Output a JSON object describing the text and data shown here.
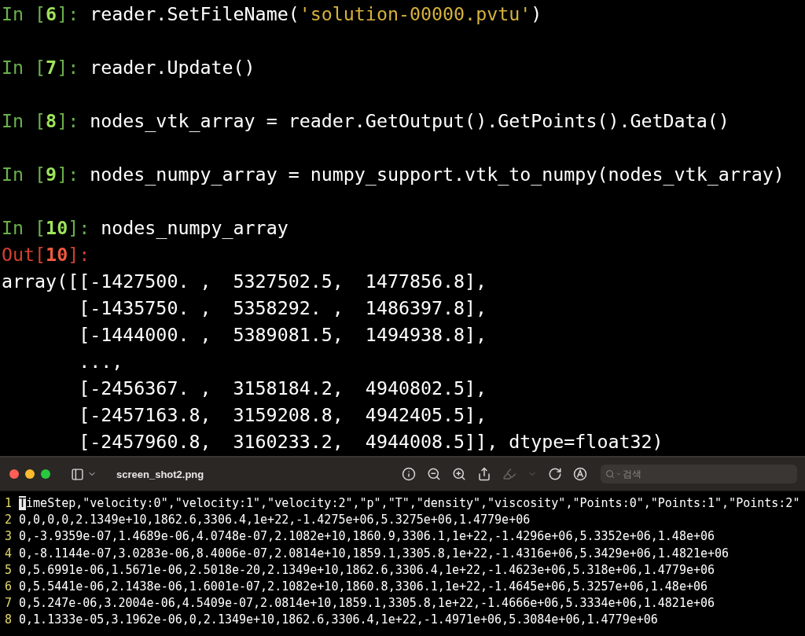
{
  "terminal": {
    "cells": [
      {
        "kind": "input",
        "prompt_open": "In [",
        "number": "6",
        "prompt_close": "]: ",
        "code": [
          {
            "kind": "plain",
            "text": "reader.SetFileName("
          },
          {
            "kind": "string",
            "text": "'solution-00000.pvtu'"
          },
          {
            "kind": "plain",
            "text": ")"
          }
        ]
      },
      {
        "kind": "input",
        "prompt_open": "In [",
        "number": "7",
        "prompt_close": "]: ",
        "code": [
          {
            "kind": "plain",
            "text": "reader.Update()"
          }
        ]
      },
      {
        "kind": "input",
        "prompt_open": "In [",
        "number": "8",
        "prompt_close": "]: ",
        "code": [
          {
            "kind": "plain",
            "text": "nodes_vtk_array = reader.GetOutput().GetPoints().GetData()"
          }
        ]
      },
      {
        "kind": "input",
        "prompt_open": "In [",
        "number": "9",
        "prompt_close": "]: ",
        "code": [
          {
            "kind": "plain",
            "text": "nodes_numpy_array = numpy_support.vtk_to_numpy(nodes_vtk_array)"
          }
        ]
      },
      {
        "kind": "input",
        "prompt_open": "In [",
        "number": "10",
        "prompt_close": "]: ",
        "code": [
          {
            "kind": "plain",
            "text": "nodes_numpy_array"
          }
        ]
      },
      {
        "kind": "output",
        "prompt_open": "Out[",
        "number": "10",
        "prompt_close": "]:",
        "lines": [
          "array([[-1427500. ,  5327502.5,  1477856.8],",
          "       [-1435750. ,  5358292. ,  1486397.8],",
          "       [-1444000. ,  5389081.5,  1494938.8],",
          "       ...,",
          "       [-2456367. ,  3158184.2,  4940802.5],",
          "       [-2457163.8,  3159208.8,  4942405.5],",
          "       [-2457960.8,  3160233.2,  4944008.5]], dtype=float32)"
        ]
      }
    ]
  },
  "viewer": {
    "title": "screen_shot2.png",
    "search": {
      "placeholder": "검색"
    },
    "toolbar": [
      {
        "kind": "info",
        "disabled": false
      },
      {
        "kind": "zoom-out",
        "disabled": false
      },
      {
        "kind": "zoom-in",
        "disabled": false
      },
      {
        "kind": "share",
        "disabled": false
      },
      {
        "kind": "highlight",
        "disabled": true
      },
      {
        "kind": "menu-caret",
        "disabled": true
      },
      {
        "kind": "rotate",
        "disabled": false
      },
      {
        "kind": "markup",
        "disabled": false
      }
    ],
    "lines": [
      {
        "number": "1",
        "text": "TimeStep,\"velocity:0\",\"velocity:1\",\"velocity:2\",\"p\",\"T\",\"density\",\"viscosity\",\"Points:0\",\"Points:1\",\"Points:2\"",
        "cursor": true
      },
      {
        "number": "2",
        "text": "0,0,0,0,2.1349e+10,1862.6,3306.4,1e+22,-1.4275e+06,5.3275e+06,1.4779e+06",
        "cursor": false
      },
      {
        "number": "3",
        "text": "0,-3.9359e-07,1.4689e-06,4.0748e-07,2.1082e+10,1860.9,3306.1,1e+22,-1.4296e+06,5.3352e+06,1.48e+06",
        "cursor": false
      },
      {
        "number": "4",
        "text": "0,-8.1144e-07,3.0283e-06,8.4006e-07,2.0814e+10,1859.1,3305.8,1e+22,-1.4316e+06,5.3429e+06,1.4821e+06",
        "cursor": false
      },
      {
        "number": "5",
        "text": "0,5.6991e-06,1.5671e-06,2.5018e-20,2.1349e+10,1862.6,3306.4,1e+22,-1.4623e+06,5.318e+06,1.4779e+06",
        "cursor": false
      },
      {
        "number": "6",
        "text": "0,5.5441e-06,2.1438e-06,1.6001e-07,2.1082e+10,1860.8,3306.1,1e+22,-1.4645e+06,5.3257e+06,1.48e+06",
        "cursor": false
      },
      {
        "number": "7",
        "text": "0,5.247e-06,3.2004e-06,4.5409e-07,2.0814e+10,1859.1,3305.8,1e+22,-1.4666e+06,5.3334e+06,1.4821e+06",
        "cursor": false
      },
      {
        "number": "8",
        "text": "0,1.1333e-05,3.1962e-06,0,2.1349e+10,1862.6,3306.4,1e+22,-1.4971e+06,5.3084e+06,1.4779e+06",
        "cursor": false
      }
    ]
  }
}
